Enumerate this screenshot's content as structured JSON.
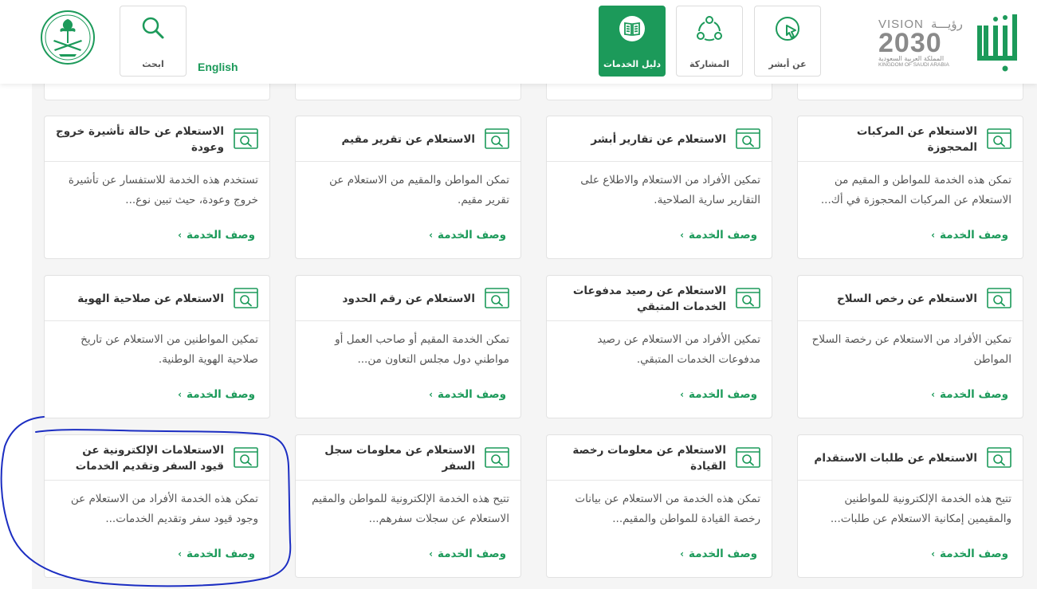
{
  "header": {
    "nav": [
      {
        "id": "about",
        "label": "عن أبشر",
        "icon": "cursor-icon"
      },
      {
        "id": "participation",
        "label": "المشاركة",
        "icon": "network-icon"
      },
      {
        "id": "services-guide",
        "label": "دليل الخدمات",
        "icon": "book-icon",
        "active": true
      }
    ],
    "search": {
      "label": "ابحث",
      "icon": "search-icon"
    },
    "english_link": "English",
    "vision": {
      "en": "VISION",
      "ar": "رؤيـــة",
      "year": "2030",
      "kingdom_ar": "المملكة العربية السعودية",
      "kingdom_en": "KINGDOM OF SAUDI ARABIA"
    },
    "absher_logo_text": "أبشر"
  },
  "colors": {
    "brand_green": "#1c9a5a",
    "background": "#f5f5f5",
    "border": "#e2e2e2"
  },
  "card_link_label": "وصف الخدمة",
  "cards": [
    {
      "title": "الاستعلام عن المركبات المحجوزة",
      "desc": "تمكن هذه الخدمة للمواطن و المقيم من الاستعلام عن المركبات المحجوزة في أك..."
    },
    {
      "title": "الاستعلام عن تقارير أبشر",
      "desc": "تمكين الأفراد من الاستعلام والاطلاع على التقارير سارية الصلاحية."
    },
    {
      "title": "الاستعلام عن تقرير مقيم",
      "desc": "تمكن المواطن والمقيم من الاستعلام عن تقرير مقيم."
    },
    {
      "title": "الاستعلام عن حالة تأشيرة خروج وعودة",
      "desc": "تستخدم هذه الخدمة للاستفسار عن تأشيرة خروج وعودة، حيث تبين نوع..."
    },
    {
      "title": "الاستعلام عن رخص السلاح",
      "desc": "تمكين الأفراد من الاستعلام عن رخصة السلاح المواطن"
    },
    {
      "title": "الاستعلام عن رصيد مدفوعات الخدمات المتبقي",
      "desc": "تمكين الأفراد من الاستعلام عن رصيد مدفوعات الخدمات المتبقي."
    },
    {
      "title": "الاستعلام عن رقم الحدود",
      "desc": "تمكن الخدمة المقيم أو صاحب العمل أو مواطني دول مجلس التعاون من..."
    },
    {
      "title": "الاستعلام عن صلاحية الهوية",
      "desc": "تمكين المواطنين من الاستعلام عن تاريخ صلاحية الهوية الوطنية."
    },
    {
      "title": "الاستعلام عن طلبات الاستقدام",
      "desc": "تتيح هذه الخدمة الإلكترونية للمواطنين والمقيمين إمكانية الاستعلام عن طلبات..."
    },
    {
      "title": "الاستعلام عن معلومات رخصة القيادة",
      "desc": "تمكن هذه الخدمة من الاستعلام عن بيانات رخصة القيادة للمواطن والمقيم..."
    },
    {
      "title": "الاستعلام عن معلومات سجل السفر",
      "desc": "تتيح هذه الخدمة الإلكترونية للمواطن والمقيم الاستعلام عن سجلات سفرهم..."
    },
    {
      "title": "الاستعلامات الإلكترونية عن قيود السفر وتقديم الخدمات",
      "desc": "تمكن هذه الخدمة الأفراد من الاستعلام عن وجود قيود سفر وتقديم الخدمات..."
    }
  ]
}
